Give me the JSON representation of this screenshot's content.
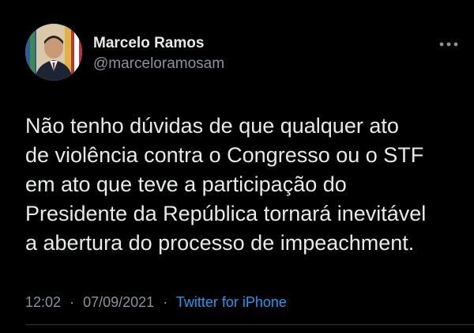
{
  "author": {
    "display_name": "Marcelo Ramos",
    "handle": "@marceloramosam",
    "avatar_icon": "profile-photo"
  },
  "more_icon": "more-horizontal-icon",
  "tweet": {
    "lines": [
      "Não tenho dúvidas de que qualquer ato",
      "de violência contra o Congresso ou o STF",
      "em ato que teve a participação do",
      "Presidente da República tornará inevitável",
      "a abertura do processo de impeachment."
    ]
  },
  "meta": {
    "time": "12:02",
    "separator": "·",
    "date": "07/09/2021",
    "source": "Twitter for iPhone"
  },
  "colors": {
    "background": "#000000",
    "text": "#e7e9ea",
    "secondary": "#8b9298",
    "link": "#1d9bf0"
  }
}
